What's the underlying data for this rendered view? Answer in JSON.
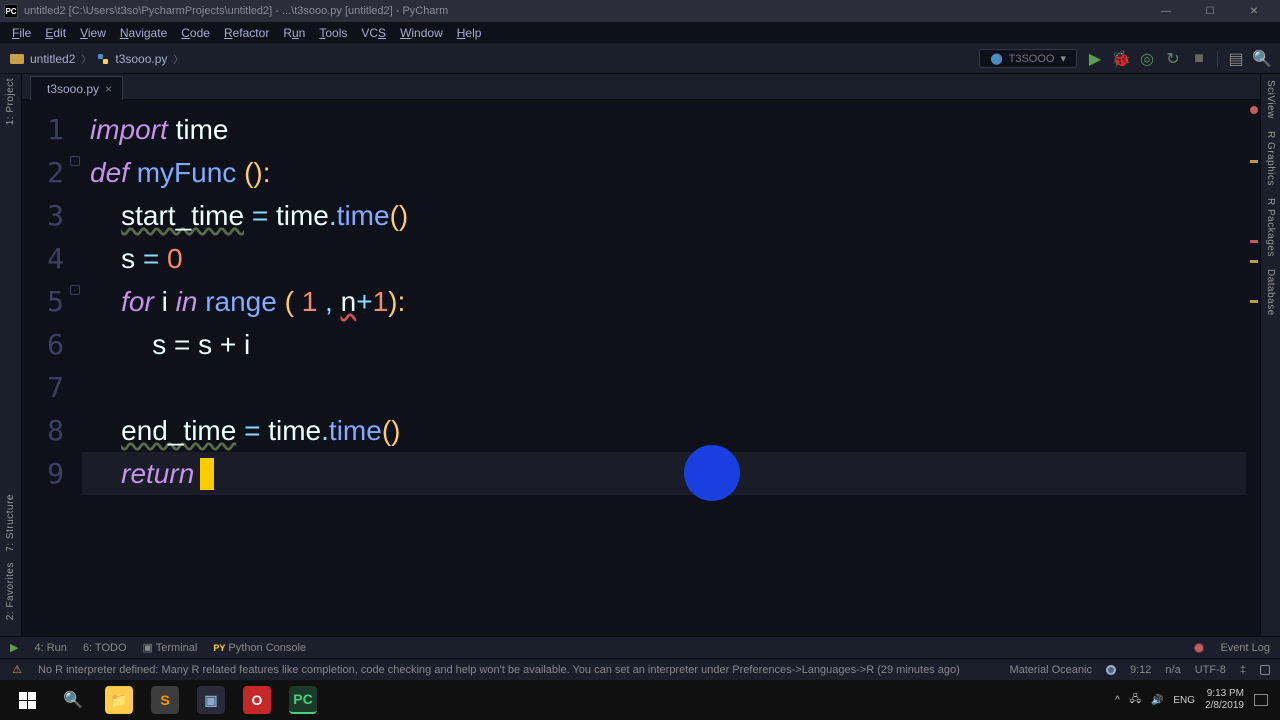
{
  "titlebar": {
    "icon_text": "PC",
    "title": "untitled2 [C:\\Users\\t3so\\PycharmProjects\\untitled2] - ...\\t3sooo.py [untitled2] - PyCharm"
  },
  "menubar": [
    "File",
    "Edit",
    "View",
    "Navigate",
    "Code",
    "Refactor",
    "Run",
    "Tools",
    "VCS",
    "Window",
    "Help"
  ],
  "breadcrumb": {
    "project": "untitled2",
    "file": "t3sooo.py"
  },
  "runconfig": {
    "label": "T3SOOO"
  },
  "toolbar_buttons": {
    "run": "▶",
    "debug": "●",
    "coverage": "◉",
    "attach": "↻",
    "stop": "■",
    "search": "🔍"
  },
  "tabs": [
    {
      "name": "t3sooo.py"
    }
  ],
  "gutter_lines": [
    "1",
    "2",
    "3",
    "4",
    "5",
    "6",
    "7",
    "8",
    "9"
  ],
  "code": {
    "l1": {
      "kw": "import",
      "id": "time"
    },
    "l2": {
      "kw": "def",
      "fn": "myFunc",
      "par": "():"
    },
    "l3": {
      "var": "start_time",
      "eq": " = ",
      "obj": "time",
      "dot": ".",
      "call": "time",
      "par2": "()"
    },
    "l4": {
      "var": "s",
      "eq": " = ",
      "num": "0"
    },
    "l5": {
      "kw1": "for",
      "var": "i",
      "kw2": "in",
      "fn": "range",
      "par1": " ( ",
      "num1": "1",
      "com": " , ",
      "err": "n",
      "op": "+",
      "num2": "1",
      "par2": "):"
    },
    "l6": {
      "text": "s = s + i"
    },
    "l8": {
      "var": "end_time",
      "eq": " = ",
      "obj": "time",
      "dot": ".",
      "call": "time",
      "par2": "()"
    },
    "l9": {
      "kw": "return"
    }
  },
  "leftrail": [
    "1: Project",
    "7: Structure",
    "2: Favorites"
  ],
  "rightrail": [
    "SciView",
    "R Graphics",
    "R Packages",
    "Database"
  ],
  "bottombar": {
    "run": "4: Run",
    "todo": "6: TODO",
    "terminal": "Terminal",
    "pyconsole": "Python Console",
    "eventlog": "Event Log"
  },
  "statusbar": {
    "msg": "No R interpreter defined: Many R related features like completion, code checking and help won't be available. You can set an interpreter under Preferences->Languages->R (29 minutes ago)",
    "theme": "Material Oceanic",
    "pos": "9:12",
    "sep": "n/a",
    "enc": "UTF-8",
    "le": "‡"
  },
  "taskbar": {
    "tray": {
      "up": "^",
      "lang": "ENG",
      "time": "9:13 PM",
      "date": "2/8/2019"
    }
  }
}
